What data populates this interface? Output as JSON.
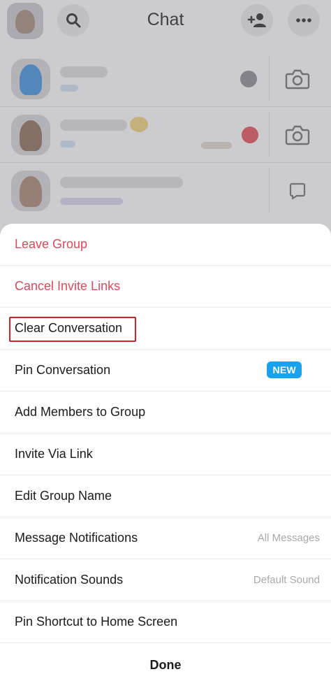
{
  "header": {
    "title": "Chat",
    "icons": [
      "search-icon",
      "add-friend-icon",
      "more-icon"
    ]
  },
  "chats": [
    {
      "avatar_color": "#3d8fe0",
      "accent": "#77b7ef",
      "action_icon": "camera-icon"
    },
    {
      "avatar_color": "#8a6a55",
      "accent": "#e84b55",
      "action_icon": "camera-icon"
    },
    {
      "avatar_color": "#a88572",
      "accent": "#b9a3e8",
      "action_icon": "chat-bubble-icon"
    }
  ],
  "menu": {
    "items": [
      {
        "label": "Leave Group",
        "style": "danger"
      },
      {
        "label": "Cancel Invite Links",
        "style": "danger"
      },
      {
        "label": "Clear Conversation",
        "style": "normal",
        "highlighted": true
      },
      {
        "label": "Pin Conversation",
        "badge": "NEW"
      },
      {
        "label": "Add Members to Group"
      },
      {
        "label": "Invite Via Link"
      },
      {
        "label": "Edit Group Name"
      },
      {
        "label": "Message Notifications",
        "value": "All Messages"
      },
      {
        "label": "Notification Sounds",
        "value": "Default Sound"
      },
      {
        "label": "Pin Shortcut to Home Screen"
      }
    ],
    "done_label": "Done"
  },
  "colors": {
    "danger": "#e1475a",
    "badge": "#1aa1ee",
    "highlight": "#d0212f"
  }
}
